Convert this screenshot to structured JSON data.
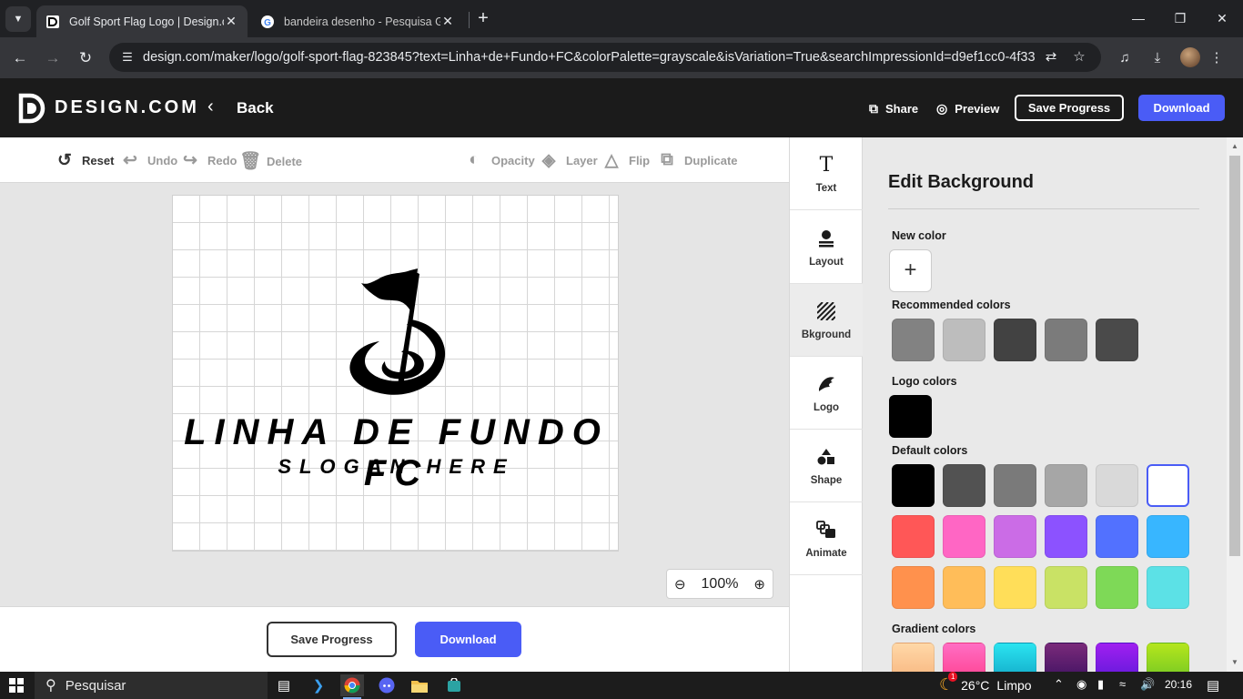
{
  "browser": {
    "tabs": [
      {
        "title": "Golf Sport Flag Logo | Design.com",
        "active": true
      },
      {
        "title": "bandeira desenho - Pesquisa Google",
        "active": false
      }
    ],
    "url": "design.com/maker/logo/golf-sport-flag-823845?text=Linha+de+Fundo+FC&colorPalette=grayscale&isVariation=True&searchImpressionId=d9ef1cc0-4f33-..."
  },
  "header": {
    "brand": "DESIGN.COM",
    "back": "Back",
    "share": "Share",
    "preview": "Preview",
    "save_progress": "Save Progress",
    "download": "Download"
  },
  "edit_toolbar": {
    "reset": "Reset",
    "undo": "Undo",
    "redo": "Redo",
    "delete": "Delete",
    "opacity": "Opacity",
    "layer": "Layer",
    "flip": "Flip",
    "duplicate": "Duplicate"
  },
  "canvas": {
    "name": "LINHA DE FUNDO FC",
    "slogan": "SLOGAN HERE"
  },
  "zoom": {
    "value": "100%"
  },
  "bottom_bar": {
    "save_progress": "Save Progress",
    "download": "Download"
  },
  "side_menu": [
    {
      "label": "Text",
      "icon": "text-icon"
    },
    {
      "label": "Layout",
      "icon": "layout-icon"
    },
    {
      "label": "Bkground",
      "icon": "background-icon",
      "active": true
    },
    {
      "label": "Logo",
      "icon": "logo-icon"
    },
    {
      "label": "Shape",
      "icon": "shape-icon"
    },
    {
      "label": "Animate",
      "icon": "animate-icon"
    }
  ],
  "panel": {
    "title": "Edit Background",
    "new_color": "New color",
    "recommended_colors": "Recommended colors",
    "logo_colors": "Logo colors",
    "default_colors": "Default colors",
    "gradient_colors": "Gradient colors",
    "recommended": [
      "#828282",
      "#bdbdbd",
      "#424242",
      "#7b7b7b",
      "#4a4a4a"
    ],
    "logo": [
      "#000000"
    ],
    "defaults": [
      [
        "#000000",
        "#525252",
        "#7a7a7a",
        "#a6a6a6",
        "#d9d9d9",
        "#ffffff"
      ],
      [
        "#ff5757",
        "#ff66c4",
        "#cb6ce6",
        "#8c52ff",
        "#5271ff",
        "#38b6ff"
      ],
      [
        "#ff914d",
        "#ffbd59",
        "#ffde59",
        "#c9e265",
        "#7ed957",
        "#5ce1e6"
      ]
    ],
    "selected_default": "#ffffff",
    "gradients": [
      [
        "#ffd8a8",
        "#f7b27a"
      ],
      [
        "#ff6ec4",
        "#ff3d8b"
      ],
      [
        "#2be4f0",
        "#0fa3c4"
      ],
      [
        "#7a2a7a",
        "#3a1060"
      ],
      [
        "#a020f0",
        "#5a18d8"
      ],
      [
        "#b5e61d",
        "#6cc424"
      ]
    ]
  },
  "taskbar": {
    "search": "Pesquisar",
    "weather_temp": "26°C",
    "weather_desc": "Limpo",
    "weather_badge": "1",
    "time": "20:16"
  }
}
